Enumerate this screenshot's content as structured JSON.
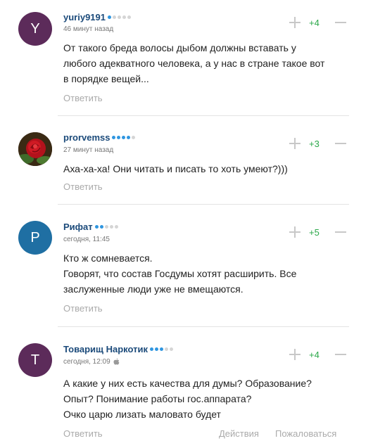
{
  "comments": [
    {
      "author": "yuriy9191",
      "rating_dots": 1,
      "time": "46 минут назад",
      "avatar_letter": "Y",
      "avatar_color": "#5c2b5a",
      "score": "+4",
      "lines": [
        "От такого бреда волосы дыбом должны вставать у",
        "любого адекватного человека, а у нас в стране такое вот",
        "в порядке вещей..."
      ],
      "reply": "Ответить"
    },
    {
      "author": "prorvemss",
      "rating_dots": 4,
      "time": "27 минут назад",
      "avatar_icon": "rose-photo-icon",
      "score": "+3",
      "lines": [
        "Аха-ха-ха! Они читать и писать то хоть умеют?)))"
      ],
      "reply": "Ответить"
    },
    {
      "author": "Рифат",
      "rating_dots": 2,
      "time": "сегодня, 11:45",
      "avatar_letter": "P",
      "avatar_color": "#1f6fa3",
      "score": "+5",
      "lines": [
        "Кто ж сомневается.",
        "Говорят, что состав Госдумы хотят расширить. Все",
        "заслуженные люди уже не вмещаются."
      ],
      "reply": "Ответить"
    },
    {
      "author": "Товарищ Наркотик",
      "rating_dots": 3,
      "time": "сегодня, 12:09",
      "time_icon": "apple-icon",
      "avatar_letter": "T",
      "avatar_color": "#5c2b5a",
      "score": "+4",
      "lines": [
        "А какие у них есть качества для думы? Образование?",
        "Опыт? Понимание работы гос.аппарата?",
        "Очко царю лизать маловато будет"
      ],
      "reply": "Ответить",
      "actions": [
        "Действия",
        "Пожаловаться"
      ]
    }
  ]
}
